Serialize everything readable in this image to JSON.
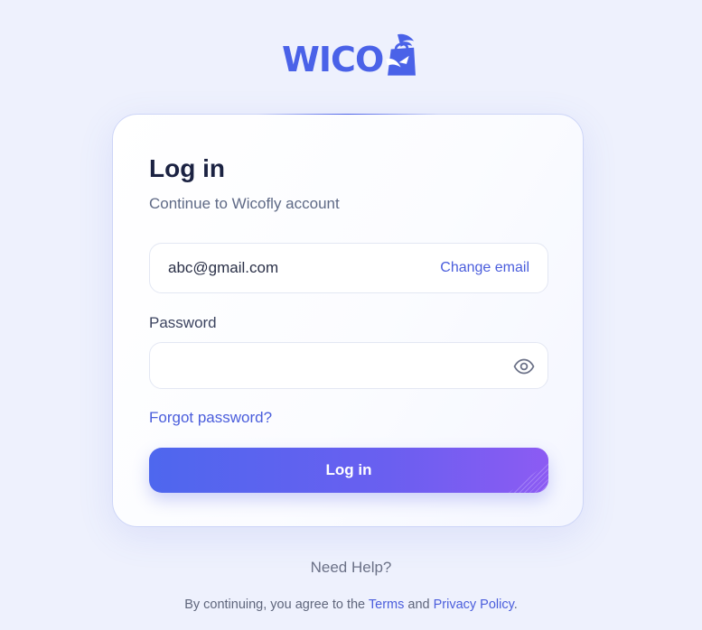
{
  "brand": {
    "logo_text": "WICO",
    "logo_color": "#4a62e8"
  },
  "card": {
    "title": "Log in",
    "subtitle": "Continue to Wicofly account"
  },
  "email": {
    "value": "abc@gmail.com",
    "change_label": "Change email"
  },
  "password": {
    "label": "Password",
    "value": "",
    "placeholder": "",
    "toggle_icon": "eye-icon"
  },
  "forgot_label": "Forgot password?",
  "login_button": {
    "label": "Log in"
  },
  "help_label": "Need Help?",
  "legal": {
    "prefix": "By continuing, you agree to the ",
    "terms": "Terms",
    "and": " and ",
    "privacy": "Privacy Policy",
    "suffix": "."
  },
  "colors": {
    "background": "#eef1fd",
    "accent": "#4a5ddc",
    "button_gradient_start": "#4e67ee",
    "button_gradient_end": "#8c5bf3"
  }
}
